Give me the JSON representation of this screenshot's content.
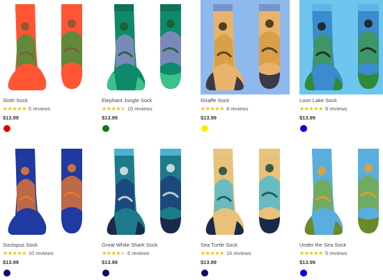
{
  "products": [
    {
      "name": "Sloth Sock",
      "rating": 5,
      "reviews": "5 reviews",
      "price": "$13.99",
      "swatch": "#e50000",
      "sky": "#ffffff",
      "body": "#ff5533",
      "accent": "#2e9a3e",
      "motif": "#7a5a3a",
      "toe": "#ff5533",
      "cuff": "#ff5533"
    },
    {
      "name": "Elephant Jungle Sock",
      "rating": 4.6,
      "reviews": "10 reviews",
      "price": "$13.99",
      "swatch": "#0a7a17",
      "sky": "#ffffff",
      "body": "#0e8a6a",
      "accent": "#9d8ad6",
      "motif": "#1d5a2a",
      "toe": "#3ac28a",
      "cuff": "#0d6f59"
    },
    {
      "name": "Giraffe Sock",
      "rating": 5,
      "reviews": "4 reviews",
      "price": "$13.99",
      "swatch": "#fff000",
      "sky": "#8fb8ee",
      "body": "#e8b36a",
      "accent": "#d49a3c",
      "motif": "#3a2a1a",
      "toe": "#3a3a4a",
      "cuff": "#6d8fd2"
    },
    {
      "name": "Loon Lake Sock",
      "rating": 5,
      "reviews": "9 reviews",
      "price": "$13.99",
      "swatch": "#0000dd",
      "sky": "#6ec6ef",
      "body": "#3a8ccf",
      "accent": "#3e9a45",
      "motif": "#1a1a1a",
      "toe": "#2f8a3a",
      "cuff": "#62b9e8"
    },
    {
      "name": "Soctopus Sock",
      "rating": 5,
      "reviews": "10 reviews",
      "price": "$13.99",
      "swatch": "#0a0a66",
      "sky": "#ffffff",
      "body": "#1f3aa0",
      "accent": "#f07a2a",
      "motif": "#f07a2a",
      "toe": "#1f3aa0",
      "cuff": "#1f3aa0"
    },
    {
      "name": "Great White Shark Sock",
      "rating": 4.5,
      "reviews": "6 reviews",
      "price": "$13.99",
      "swatch": "#0a0a66",
      "sky": "#ffffff",
      "body": "#1d7a8a",
      "accent": "#1a3a7a",
      "motif": "#e8e8e8",
      "toe": "#1a2a4a",
      "cuff": "#4fb9d9"
    },
    {
      "name": "Sea Turtle Sock",
      "rating": 5,
      "reviews": "16 reviews",
      "price": "$13.99",
      "swatch": "#0a0a66",
      "sky": "#ffffff",
      "body": "#e8c27a",
      "accent": "#3fb8d8",
      "motif": "#1a4a3a",
      "toe": "#1a2a4a",
      "cuff": "#e6c680"
    },
    {
      "name": "Under the Sea Sock",
      "rating": 5,
      "reviews": "5 reviews",
      "price": "$13.99",
      "swatch": "#0000dd",
      "sky": "#ffffff",
      "body": "#5aaede",
      "accent": "#7aaa3a",
      "motif": "#f2a020",
      "toe": "#6a8a2a",
      "cuff": "#5aaede"
    }
  ]
}
